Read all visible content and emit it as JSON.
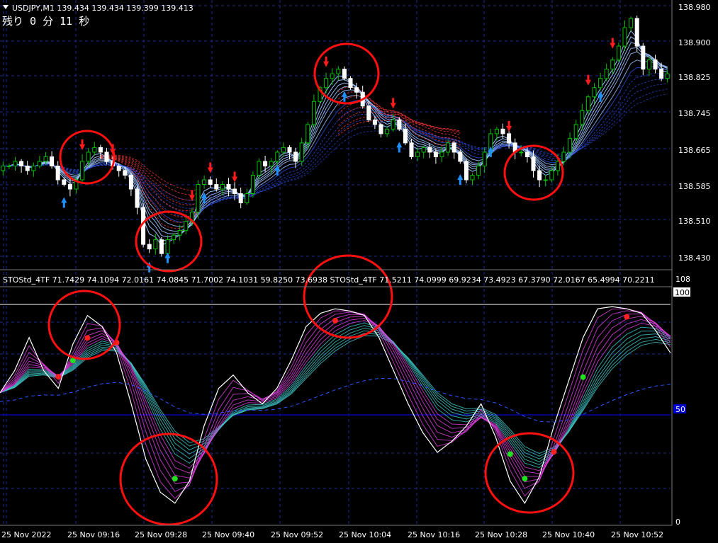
{
  "header": {
    "symbol_line": "USDJPY,M1  139.434 139.434 139.399 139.413",
    "countdown": "残り 0 分 11 秒"
  },
  "price_axis": [
    "138.980",
    "138.900",
    "138.825",
    "138.745",
    "138.665",
    "138.585",
    "138.510",
    "138.430"
  ],
  "indicator": {
    "label": "STOStd_4TF 71.7429 74.1094 72.0161 74.0845 71.7002 74.1031 59.8250 73.6938  STOStd_4TF 71.5211 74.0999 69.9234 73.4923 67.3790 72.0167 65.4994 70.2211",
    "axis_top": "108",
    "level_100": "100",
    "level_50": "50",
    "axis_bottom": "0"
  },
  "time_axis": [
    "25 Nov 2022",
    "25 Nov 09:16",
    "25 Nov 09:28",
    "25 Nov 09:40",
    "25 Nov 09:52",
    "25 Nov 10:04",
    "25 Nov 10:16",
    "25 Nov 10:28",
    "25 Nov 10:40",
    "25 Nov 10:52"
  ],
  "colors": {
    "background": "#000000",
    "grid": "#1c2c8a",
    "bull_candle": "#00c000",
    "bear_candle": "#ffffff",
    "sell_arrow": "#ff1c1c",
    "buy_arrow": "#1e90ff",
    "ma_fast": "#9ec4ff",
    "ma_slow": "#2f4fe0",
    "ma_red": "#ff3a3a",
    "stoch_main": "#ffffff",
    "stoch_magenta": "#e040e0",
    "stoch_cyan": "#40c8c8",
    "level_line": "#0000cc",
    "dot_red": "#ff2020",
    "dot_green": "#20e020",
    "circle": "#ff1010"
  },
  "chart_data": [
    {
      "type": "candlestick",
      "title": "USDJPY,M1",
      "timeframe": "M1",
      "ylim": [
        138.405,
        138.99
      ],
      "last_ohlc": {
        "open": 139.434,
        "high": 139.434,
        "low": 139.399,
        "close": 139.413
      },
      "price_path": [
        138.63,
        138.63,
        138.64,
        138.63,
        138.62,
        138.63,
        138.64,
        138.65,
        138.63,
        138.6,
        138.59,
        138.58,
        138.6,
        138.64,
        138.66,
        138.67,
        138.66,
        138.64,
        138.63,
        138.62,
        138.61,
        138.58,
        138.54,
        138.46,
        138.45,
        138.47,
        138.44,
        138.47,
        138.48,
        138.49,
        138.51,
        138.53,
        138.59,
        138.6,
        138.59,
        138.58,
        138.59,
        138.58,
        138.57,
        138.55,
        138.57,
        138.61,
        138.64,
        138.63,
        138.64,
        138.66,
        138.67,
        138.66,
        138.64,
        138.68,
        138.72,
        138.77,
        138.8,
        138.82,
        138.83,
        138.84,
        138.82,
        138.8,
        138.79,
        138.76,
        138.73,
        138.72,
        138.7,
        138.71,
        138.73,
        138.71,
        138.68,
        138.65,
        138.66,
        138.67,
        138.66,
        138.65,
        138.66,
        138.68,
        138.66,
        138.64,
        138.6,
        138.61,
        138.63,
        138.66,
        138.7,
        138.71,
        138.7,
        138.68,
        138.66,
        138.66,
        138.65,
        138.62,
        138.6,
        138.6,
        138.62,
        138.64,
        138.66,
        138.69,
        138.72,
        138.75,
        138.78,
        138.8,
        138.82,
        138.84,
        138.86,
        138.89,
        138.93,
        138.95,
        138.89,
        138.84,
        138.86,
        138.84,
        138.82,
        138.83
      ],
      "sell_arrows_at": [
        13,
        18,
        31,
        34,
        38,
        53,
        64,
        83,
        96,
        100
      ],
      "buy_arrows_at": [
        10,
        24,
        27,
        33,
        45,
        56,
        65,
        75,
        80,
        98
      ]
    },
    {
      "type": "line",
      "title": "STOStd_4TF",
      "ylim": [
        0,
        108
      ],
      "levels": [
        100,
        50
      ],
      "series": [
        {
          "name": "STOStd_4TF",
          "values": [
            72,
            74,
            72,
            74,
            72,
            74,
            60,
            74,
            71.5,
            74.1,
            69.9,
            73.5,
            67.4,
            72.0,
            65.5,
            70.2
          ]
        }
      ],
      "main_path": [
        60,
        70,
        85,
        70,
        62,
        82,
        95,
        90,
        78,
        55,
        30,
        15,
        10,
        20,
        45,
        62,
        68,
        60,
        55,
        62,
        75,
        90,
        96,
        98,
        97,
        95,
        85,
        70,
        55,
        42,
        33,
        38,
        45,
        55,
        40,
        20,
        10,
        22,
        45,
        65,
        85,
        98,
        99,
        98,
        96,
        88,
        78
      ]
    }
  ]
}
